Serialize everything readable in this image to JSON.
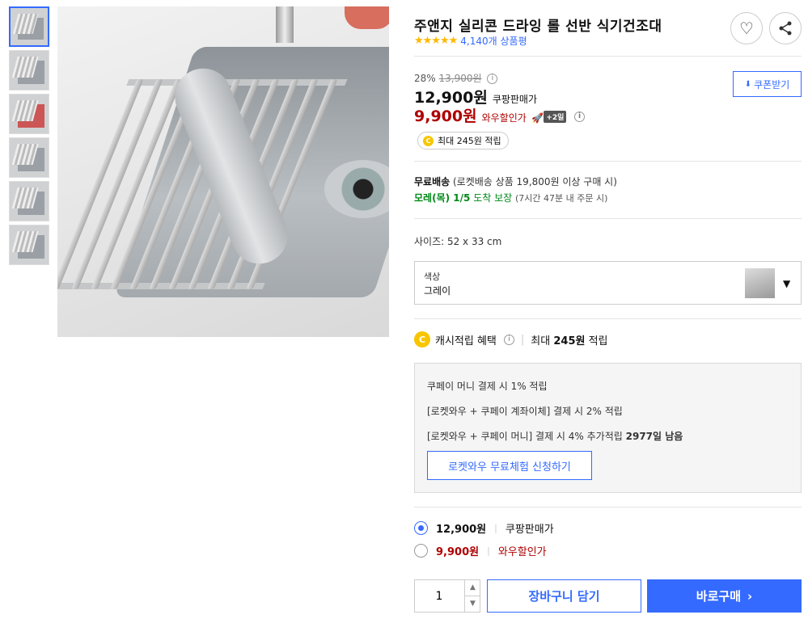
{
  "product": {
    "title": "주앤지 실리콘 드라잉 롤 선반 식기건조대",
    "stars": "★★★★★",
    "review_count": "4,140개 상품평",
    "rating_value": 5
  },
  "icons": {
    "wishlist": "heart-icon",
    "share": "share-icon"
  },
  "price": {
    "discount_rate": "28%",
    "original_price": "13,900원",
    "info_mark": "i",
    "sale_price": "12,900원",
    "sale_label": "쿠팡판매가",
    "wow_price": "9,900원",
    "wow_label": "와우할인가",
    "wow_badge": "+2일",
    "coupon_label": "쿠폰받기",
    "cash_pill": "최대 245원 적립",
    "coin_letter": "C"
  },
  "shipping": {
    "free_label": "무료배송",
    "free_detail": "(로켓배송 상품 19,800원 이상 구매 시)",
    "arrival_date": "모레(목) 1/5",
    "arrival_suffix": "도착 보장",
    "arrival_note": "(7시간 47분 내 주문 시)"
  },
  "size": {
    "text": "사이즈: 52 x 33 cm"
  },
  "option": {
    "label": "색상",
    "value": "그레이"
  },
  "cashback": {
    "label": "캐시적립 혜택",
    "amount_prefix": "최대 ",
    "amount": "245원",
    "amount_suffix": " 적립"
  },
  "benefits": {
    "line1": "쿠페이 머니 결제 시 1% 적립",
    "line2": "[로켓와우 + 쿠페이 계좌이체] 결제 시 2% 적립",
    "line3_text": "[로켓와우 + 쿠페이 머니] 결제 시 4% 추가적립 ",
    "line3_days": "2977일 남음",
    "trial_button": "로켓와우 무료체험 신청하기"
  },
  "price_options": [
    {
      "price": "12,900원",
      "label": "쿠팡판매가",
      "selected": true
    },
    {
      "price": "9,900원",
      "label": "와우할인가",
      "selected": false
    }
  ],
  "purchase": {
    "quantity": "1",
    "cart_button": "장바구니 담기",
    "buy_button": "바로구매"
  },
  "colors": {
    "accent": "#346aff",
    "sale_red": "#ae0000",
    "green": "#00891a",
    "star": "#ffb800"
  }
}
